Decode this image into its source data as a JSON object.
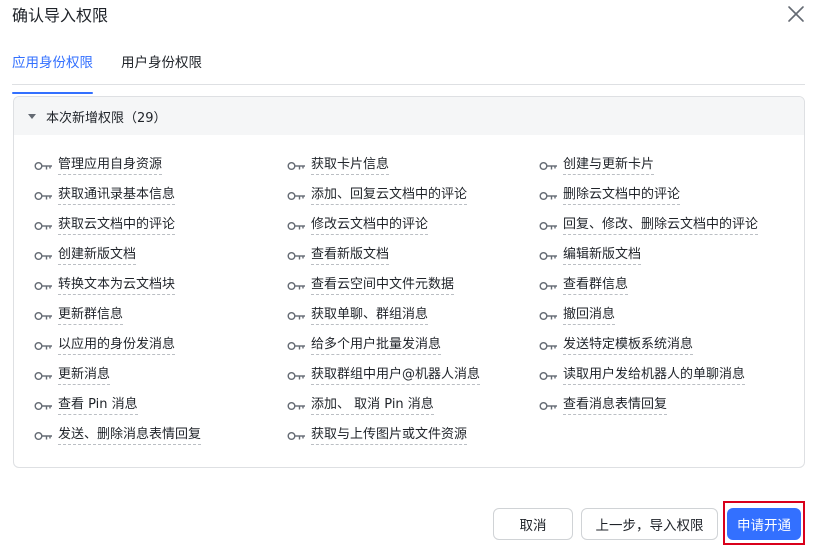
{
  "dialog": {
    "title": "确认导入权限"
  },
  "tabs": [
    {
      "label": "应用身份权限",
      "active": true
    },
    {
      "label": "用户身份权限",
      "active": false
    }
  ],
  "panel": {
    "header": "本次新增权限（29）",
    "columns": [
      [
        "管理应用自身资源",
        "获取通讯录基本信息",
        "获取云文档中的评论",
        "创建新版文档",
        "转换文本为云文档块",
        "更新群信息",
        "以应用的身份发消息",
        "更新消息",
        "查看 Pin 消息",
        "发送、删除消息表情回复"
      ],
      [
        "获取卡片信息",
        "添加、回复云文档中的评论",
        "修改云文档中的评论",
        "查看新版文档",
        "查看云空间中文件元数据",
        "获取单聊、群组消息",
        "给多个用户批量发消息",
        "获取群组中用户@机器人消息",
        "添加、 取消 Pin 消息",
        "获取与上传图片或文件资源"
      ],
      [
        "创建与更新卡片",
        "删除云文档中的评论",
        "回复、修改、删除云文档中的评论",
        "编辑新版文档",
        "查看群信息",
        "撤回消息",
        "发送特定模板系统消息",
        "读取用户发给机器人的单聊消息",
        "查看消息表情回复"
      ]
    ]
  },
  "footer": {
    "cancel_label": "取消",
    "prev_label": "上一步，导入权限",
    "submit_label": "申请开通"
  },
  "colors": {
    "accent": "#3370ff",
    "highlight": "#d9001b"
  },
  "icons": {
    "close": "close-icon",
    "collapse": "caret-down-icon",
    "permission": "key-icon"
  }
}
